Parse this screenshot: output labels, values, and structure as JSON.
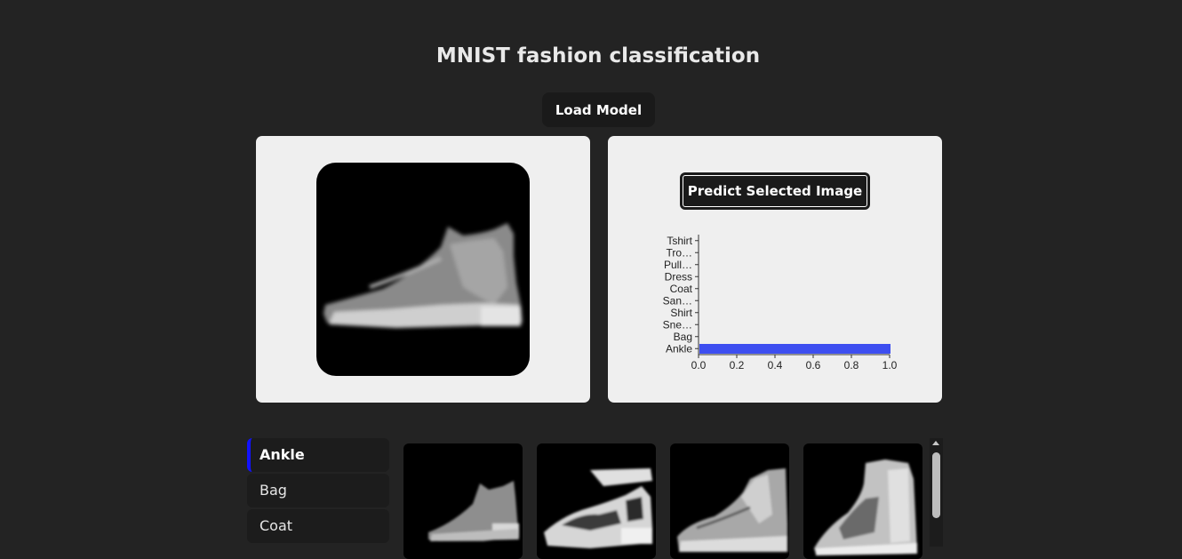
{
  "page": {
    "title": "MNIST fashion classification"
  },
  "toolbar": {
    "load_model_label": "Load Model"
  },
  "predict": {
    "button_label": "Predict Selected Image"
  },
  "chart_data": {
    "type": "bar",
    "orientation": "horizontal",
    "categories": [
      "Tshirt",
      "Tro…",
      "Pull…",
      "Dress",
      "Coat",
      "San…",
      "Shirt",
      "Sne…",
      "Bag",
      "Ankle"
    ],
    "values": [
      0,
      0,
      0,
      0,
      0,
      0,
      0,
      0,
      0,
      1.0
    ],
    "xlim": [
      0,
      1.0
    ],
    "xticks": [
      "0.0",
      "0.2",
      "0.4",
      "0.6",
      "0.8",
      "1.0"
    ],
    "bar_color": "#3d4ef0",
    "title": "",
    "xlabel": "",
    "ylabel": ""
  },
  "sidebar": {
    "items": [
      {
        "label": "Ankle",
        "active": true
      },
      {
        "label": "Bag",
        "active": false
      },
      {
        "label": "Coat",
        "active": false
      }
    ]
  },
  "thumbnails": [
    {
      "icon": "ankle-boot-thumbnail"
    },
    {
      "icon": "sandal-thumbnail"
    },
    {
      "icon": "boot-thumbnail"
    },
    {
      "icon": "high-boot-thumbnail"
    }
  ],
  "colors": {
    "accent": "#1212ff",
    "background": "#232323",
    "panel": "#efefef"
  }
}
